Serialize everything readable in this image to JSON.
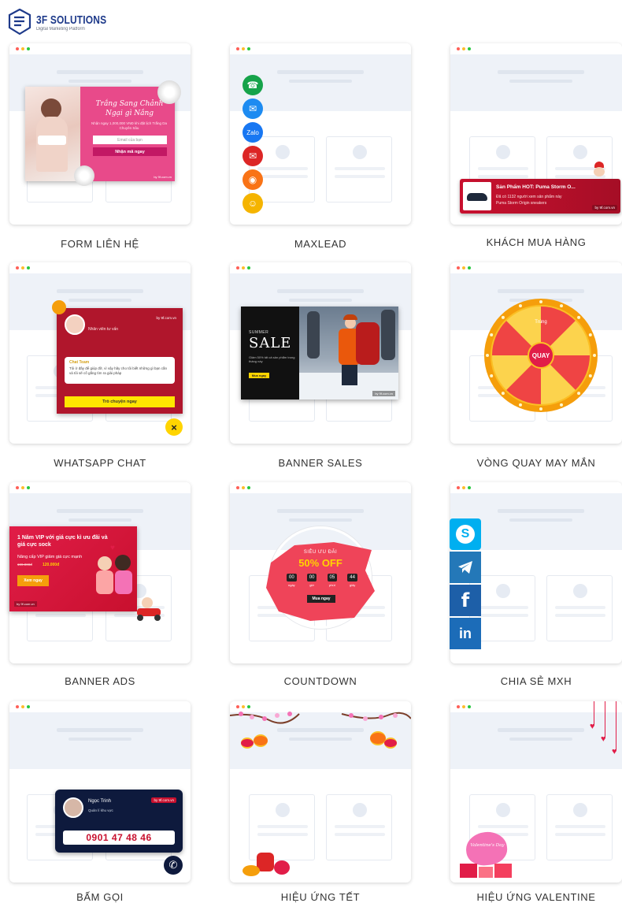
{
  "brand": {
    "name": "3F SOLUTIONS",
    "tagline": "Digital Marketing Platform",
    "color": "#1e3a8a"
  },
  "cards": [
    {
      "label": "FORM LIÊN HỆ"
    },
    {
      "label": "MAXLEAD"
    },
    {
      "label": "KHÁCH MUA HÀNG"
    },
    {
      "label": "WHATSAPP CHAT"
    },
    {
      "label": "BANNER SALES"
    },
    {
      "label": "VÒNG QUAY MAY MẮN"
    },
    {
      "label": "BANNER ADS"
    },
    {
      "label": "COUNTDOWN"
    },
    {
      "label": "CHIA SẺ MXH"
    },
    {
      "label": "BẤM GỌI"
    },
    {
      "label": "HIỆU ỨNG TẾT"
    },
    {
      "label": "HIỆU ỨNG VALENTINE"
    }
  ],
  "form_popup": {
    "title": "Trắng Sang Chảnh Ngại gì Nắng",
    "desc": "Nhận ngay 1,000,000 VNĐ khi đặt lịch Trắng Da Chuyên Sâu",
    "email_placeholder": "Email của bạn",
    "button": "Nhận mã ngay",
    "badge": "by 9f.com.vn"
  },
  "customer_popup": {
    "title": "Sản Phẩm HOT: Puma Storm O...",
    "text": "Đã có 1132 người xem sản phẩm này",
    "product": "Puma Storm Origin sneakers",
    "badge": "by 9f.com.vn"
  },
  "whatsapp_popup": {
    "name": "Chat Team",
    "status": "Nhân viên tư vấn",
    "message": "Tôi ở đây để giúp đỡ, vì vậy hãy cho tôi biết những gì bạn cần và tôi sẽ cố gắng tìm ra giải pháp",
    "button": "Trò chuyện ngay",
    "badge": "by 9f.com.vn",
    "close": "×"
  },
  "sales_banner": {
    "kicker": "SUMMER",
    "title": "SALE",
    "desc": "Giảm 50% tất cả sản phẩm trong tháng này",
    "button": "Mua ngay",
    "badge": "by 9f.com.vn"
  },
  "wheel": {
    "center": "QUAY",
    "segment_text": "Trúng"
  },
  "ads_banner": {
    "title": "1 Năm VIP với giá cực kì ưu đãi và giá cực sock",
    "sub": "Nâng cấp VIP giảm giá cực mạnh",
    "old_price": "199.000đ",
    "new_price": "120.000đ",
    "button": "Xem ngay",
    "badge": "by 9f.com.vn"
  },
  "countdown": {
    "pre": "SIÊU ƯU ĐÃI",
    "headline": "50% OFF",
    "units": [
      {
        "value": "00",
        "label": "ngày"
      },
      {
        "value": "00",
        "label": "giờ"
      },
      {
        "value": "05",
        "label": "phút"
      },
      {
        "value": "44",
        "label": "giây"
      }
    ],
    "button": "Mua ngay"
  },
  "social": {
    "skype": "S",
    "facebook": "f",
    "linkedin": "in"
  },
  "call": {
    "name": "Ngọc Trinh",
    "role": "Quản lí khu vực",
    "phone": "0901 47 48 46",
    "badge": "by 9f.com.vn"
  },
  "valentine": {
    "text": "Valentine's Day"
  },
  "colors": {
    "pink": "#e6397b",
    "red": "#c8102e",
    "yellow": "#ffd400",
    "navy": "#0e1a3d",
    "blue": "#1c6cb8"
  }
}
